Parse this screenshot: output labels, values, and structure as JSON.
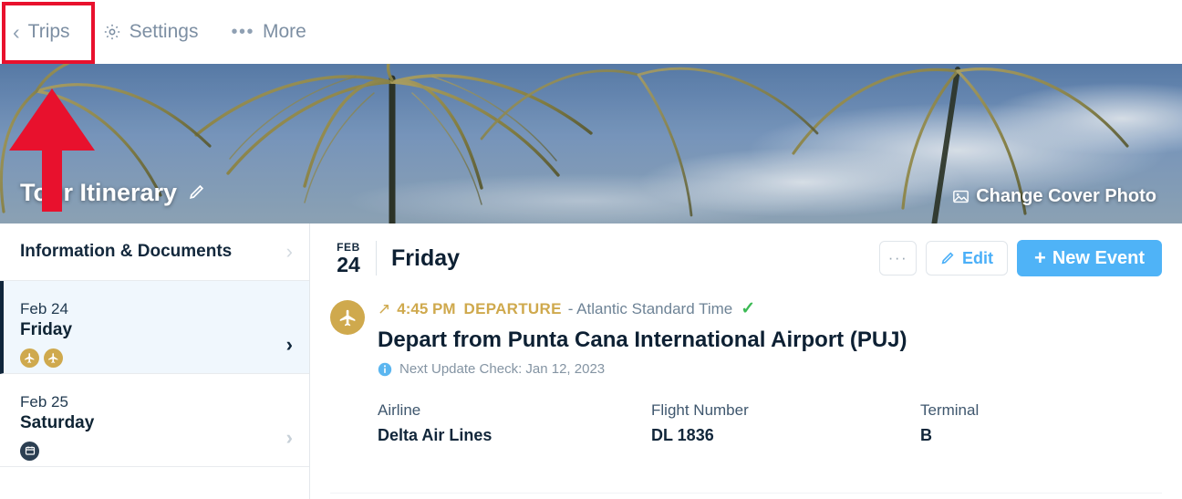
{
  "topnav": {
    "items": [
      {
        "label": "Trips",
        "icon": "chevron-left-icon"
      },
      {
        "label": "Settings",
        "icon": "gear-icon"
      },
      {
        "label": "More",
        "icon": "ellipsis-icon"
      }
    ]
  },
  "cover": {
    "title": "Tour Itinerary",
    "edit_icon": "pencil-icon",
    "change_cover_label": "Change Cover Photo",
    "change_cover_icon": "image-icon",
    "scene": "palm trees against blue sky with clouds"
  },
  "sidebar": {
    "info_row": {
      "label": "Information & Documents",
      "chevron": "chevron-right-icon"
    },
    "days": [
      {
        "date": "Feb 24",
        "weekday": "Friday",
        "active": true,
        "badges": [
          "plane-icon",
          "plane-icon"
        ],
        "chevron": "chevron-right-icon"
      },
      {
        "date": "Feb 25",
        "weekday": "Saturday",
        "active": false,
        "badges": [
          "calendar-icon"
        ],
        "chevron": "chevron-right-icon"
      }
    ]
  },
  "main": {
    "header": {
      "month": "FEB",
      "day": "24",
      "weekday": "Friday"
    },
    "actions": {
      "more_label": "···",
      "edit_label": "Edit",
      "edit_icon": "pencil-icon",
      "new_event_label": "New Event",
      "new_event_plus": "+"
    },
    "event": {
      "icon": "plane-icon",
      "direction_icon": "arrow-up-right-icon",
      "time": "4:45 PM",
      "type": "DEPARTURE",
      "timezone": "- Atlantic Standard Time",
      "verified_icon": "check-icon",
      "title": "Depart from Punta Cana International Airport (PUJ)",
      "note_icon": "info-icon",
      "note": "Next Update Check: Jan 12, 2023",
      "fields": [
        {
          "label": "Airline",
          "value": "Delta Air Lines"
        },
        {
          "label": "Flight Number",
          "value": "DL 1836"
        },
        {
          "label": "Terminal",
          "value": "B"
        }
      ]
    }
  },
  "annotations": {
    "highlight_color": "#e8112d",
    "highlight_target": "Trips",
    "arrow_color": "#e8112d",
    "arrow_direction": "up"
  },
  "colors": {
    "accent_blue": "#4fb3f7",
    "gold": "#cfa94d",
    "dark_navy": "#0d2033",
    "active_row_bg": "#f0f7fd",
    "muted": "#7d8fa3",
    "green_check": "#3cba54"
  }
}
